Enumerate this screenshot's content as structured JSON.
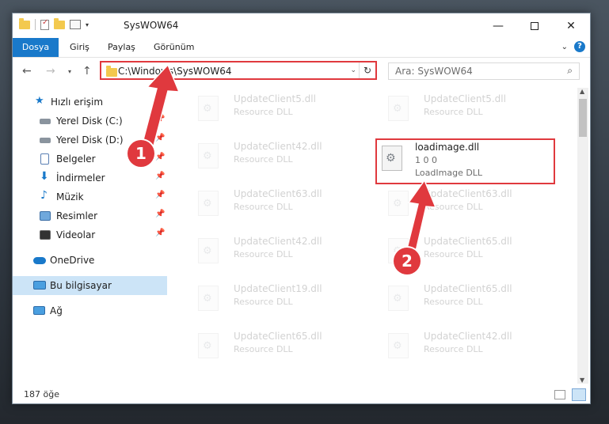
{
  "window": {
    "title": "SysWOW64"
  },
  "ribbon": {
    "tabs": [
      "Dosya",
      "Giriş",
      "Paylaş",
      "Görünüm"
    ],
    "help": "?"
  },
  "address": {
    "path": "C:\\Windows\\SysWOW64"
  },
  "search": {
    "placeholder": "Ara: SysWOW64"
  },
  "nav_pane": {
    "items": [
      {
        "label": "Hızlı erişim",
        "icon": "star-icon"
      },
      {
        "label": "Yerel Disk (C:)",
        "icon": "drive-icon",
        "pinned": true
      },
      {
        "label": "Yerel Disk (D:)",
        "icon": "drive-icon",
        "pinned": true
      },
      {
        "label": "Belgeler",
        "icon": "documents-icon",
        "pinned": true
      },
      {
        "label": "İndirmeler",
        "icon": "downloads-icon",
        "pinned": true
      },
      {
        "label": "Müzik",
        "icon": "music-icon",
        "pinned": true
      },
      {
        "label": "Resimler",
        "icon": "pictures-icon",
        "pinned": true
      },
      {
        "label": "Videolar",
        "icon": "videos-icon",
        "pinned": true
      },
      {
        "label": "OneDrive",
        "icon": "cloud-icon"
      },
      {
        "label": "Bu bilgisayar",
        "icon": "computer-icon",
        "selected": true
      },
      {
        "label": "Ağ",
        "icon": "network-icon"
      }
    ]
  },
  "files_left": [
    {
      "name": "UpdateClient5.dll",
      "desc": "Resource DLL"
    },
    {
      "name": "UpdateClient42.dll",
      "desc": "Resource DLL"
    },
    {
      "name": "UpdateClient63.dll",
      "desc": "Resource DLL"
    },
    {
      "name": "UpdateClient42.dll",
      "desc": "Resource DLL"
    },
    {
      "name": "UpdateClient19.dll",
      "desc": "Resource DLL"
    },
    {
      "name": "UpdateClient65.dll",
      "desc": "Resource DLL"
    }
  ],
  "files_right": [
    {
      "name": "UpdateClient5.dll",
      "desc": "Resource DLL"
    },
    {
      "name": "UpdateClient63.dll",
      "desc": "Resource DLL"
    },
    {
      "name": "UpdateClient65.dll",
      "desc": "Resource DLL"
    },
    {
      "name": "UpdateClient65.dll",
      "desc": "Resource DLL"
    },
    {
      "name": "UpdateClient42.dll",
      "desc": "Resource DLL"
    }
  ],
  "highlighted_file": {
    "name": "loadimage.dll",
    "version": "1 0 0",
    "desc": "LoadImage DLL"
  },
  "status": {
    "item_count": "187 öğe"
  },
  "callouts": [
    "1",
    "2"
  ],
  "colors": {
    "accent": "#1979ca",
    "highlight": "#e0393e",
    "selected": "#cce4f7"
  }
}
